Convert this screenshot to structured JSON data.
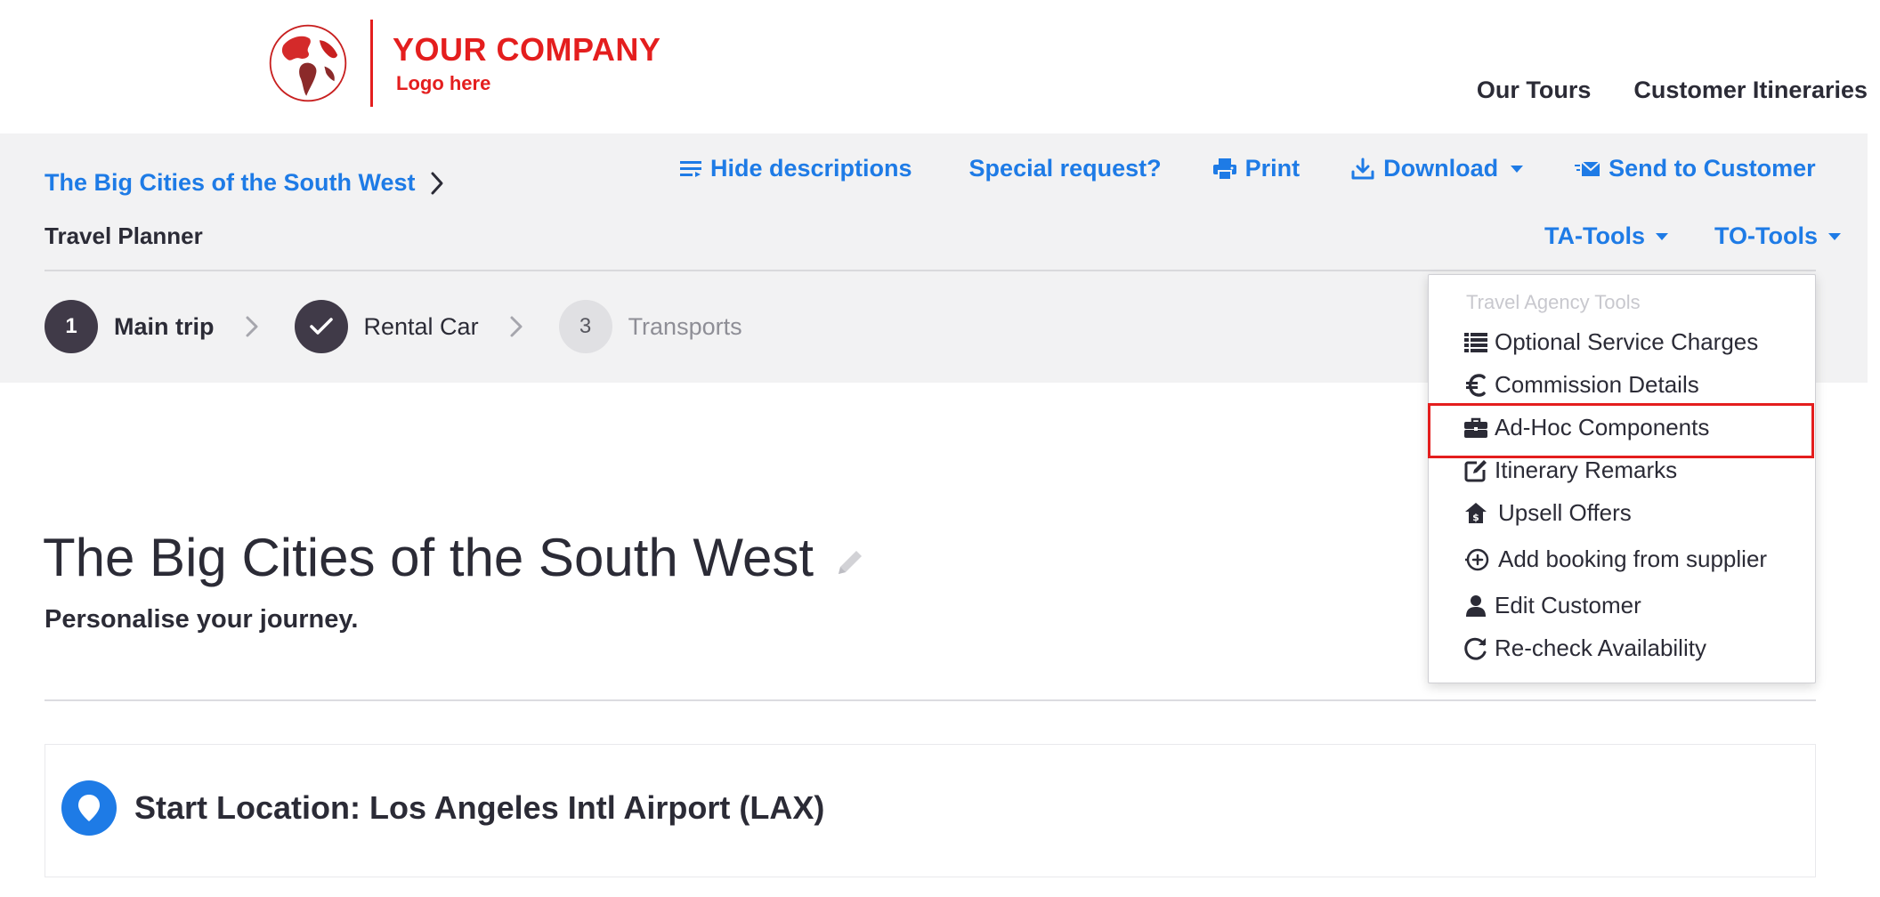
{
  "header": {
    "logo": {
      "name": "YOUR COMPANY",
      "tagline": "Logo here"
    },
    "nav": [
      {
        "label": "Our Tours"
      },
      {
        "label": "Customer Itineraries"
      }
    ]
  },
  "breadcrumb": {
    "trip_link": "The Big Cities of the South West"
  },
  "planner_label": "Travel Planner",
  "actions": {
    "hide_descriptions": "Hide descriptions",
    "special_request": "Special request?",
    "print": "Print",
    "download": "Download",
    "send_to_customer": "Send to Customer"
  },
  "tools": {
    "ta_tools": "TA-Tools",
    "to_tools": "TO-Tools"
  },
  "steps": [
    {
      "number": "1",
      "label": "Main trip",
      "state": "current"
    },
    {
      "number": "",
      "label": "Rental Car",
      "state": "completed"
    },
    {
      "number": "3",
      "label": "Transports",
      "state": "upcoming"
    }
  ],
  "main": {
    "title": "The Big Cities of the South West",
    "subtitle": "Personalise your journey.",
    "start_location": "Start Location: Los Angeles Intl Airport (LAX)"
  },
  "ta_menu": {
    "header": "Travel Agency Tools",
    "items": [
      {
        "label": "Optional Service Charges",
        "icon": "list-icon"
      },
      {
        "label": "Commission Details",
        "icon": "euro-icon"
      },
      {
        "label": "Ad-Hoc Components",
        "icon": "briefcase-icon",
        "highlighted": true
      },
      {
        "label": "Itinerary Remarks",
        "icon": "edit-icon"
      },
      {
        "label": "Upsell Offers",
        "icon": "upsell-icon"
      },
      {
        "label": "Add booking from supplier",
        "icon": "add-booking-icon"
      },
      {
        "label": "Edit Customer",
        "icon": "user-icon"
      },
      {
        "label": "Re-check Availability",
        "icon": "refresh-icon"
      }
    ]
  },
  "colors": {
    "brand_red": "#e41e1e",
    "link_blue": "#1e7be6",
    "text_dark": "#2b2b36",
    "band_gray": "#f2f2f3",
    "step_dark": "#403a48"
  }
}
